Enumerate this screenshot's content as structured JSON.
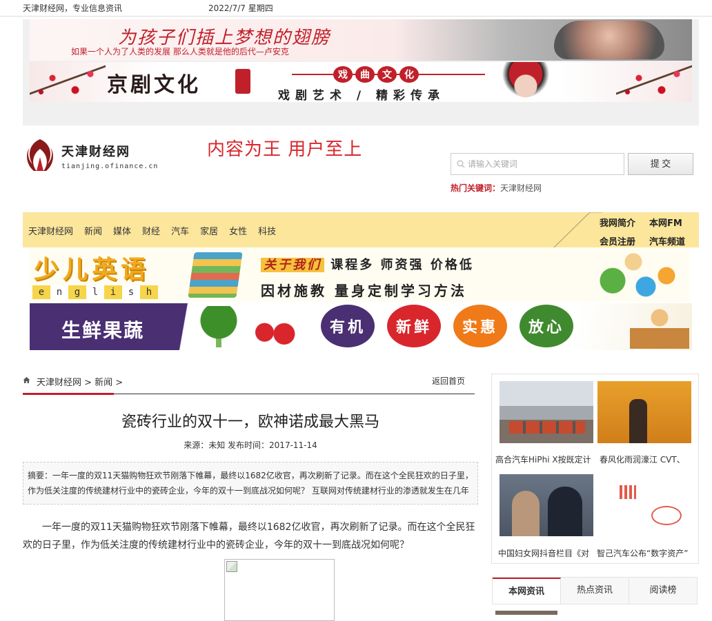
{
  "topbar": {
    "site_label": "天津财经网，专业信息资讯",
    "date": "2022/7/7 星期四"
  },
  "banners": {
    "banner1_title": "为孩子们插上梦想的翅膀",
    "banner1_quote": "如果一个人为了人类的发展 那么人类就是他的后代—卢安克",
    "banner2_title": "京剧文化",
    "banner2_tags": [
      "戏",
      "曲",
      "文",
      "化"
    ],
    "banner2_sub": "戏剧艺术 / 精彩传承"
  },
  "header": {
    "logo_name": "天津财经网",
    "logo_url": "tianjing.ofinance.cn",
    "slogan": "内容为王 用户至上",
    "search_placeholder": "请输入关键词",
    "submit_label": "提 交",
    "hot_label": "热门关键词：",
    "hot_value": "天津财经网"
  },
  "nav": {
    "items": [
      "天津财经网",
      "新闻",
      "媒体",
      "财经",
      "汽车",
      "家居",
      "女性",
      "科技"
    ],
    "right_links": [
      "我网简介",
      "本网FM",
      "会员注册",
      "汽车频道"
    ]
  },
  "ads": {
    "english_title": "少儿英语",
    "english_letters": [
      "e",
      "n",
      "g",
      "l",
      "i",
      "s",
      "h"
    ],
    "english_hl": "关于我们",
    "english_line1": "课程多 师资强 价格低",
    "english_line2": "因材施教 量身定制学习方法",
    "fresh_title": "生鲜果蔬",
    "fresh_tags": [
      {
        "label": "有机",
        "color": "#4a2f73"
      },
      {
        "label": "新鲜",
        "color": "#d8262c"
      },
      {
        "label": "实惠",
        "color": "#f07a18"
      },
      {
        "label": "放心",
        "color": "#3f8a2e"
      }
    ]
  },
  "article": {
    "breadcrumb": "天津财经网 > 新闻 >",
    "back_home": "返回首页",
    "title": "瓷砖行业的双十一，欧神诺成最大黑马",
    "meta": "来源：未知 发布时间：2017-11-14",
    "summary": "摘要：一年一度的双11天猫购物狂欢节刚落下帷幕，最终以1682亿收官，再次刷新了记录。而在这个全民狂欢的日子里，作为低关注度的传统建材行业中的瓷砖企业，今年的双十一到底战况如何呢？ 互联网对传统建材行业的渗透就发生在几年",
    "para1": "一年一度的双11天猫购物狂欢节刚落下帷幕，最终以1682亿收官，再次刷新了记录。而在这个全民狂欢的日子里，作为低关注度的传统建材行业中的瓷砖企业，今年的双十一到底战况如何呢？"
  },
  "sidebar": {
    "captions": [
      "高合汽车HiPhi X按既定计",
      "春风化雨润濠江 CVT、",
      "中国妇女网抖音栏目《对",
      "智己汽车公布“数字资产”"
    ],
    "tabs": [
      "本网资讯",
      "热点资讯",
      "阅读榜"
    ]
  }
}
